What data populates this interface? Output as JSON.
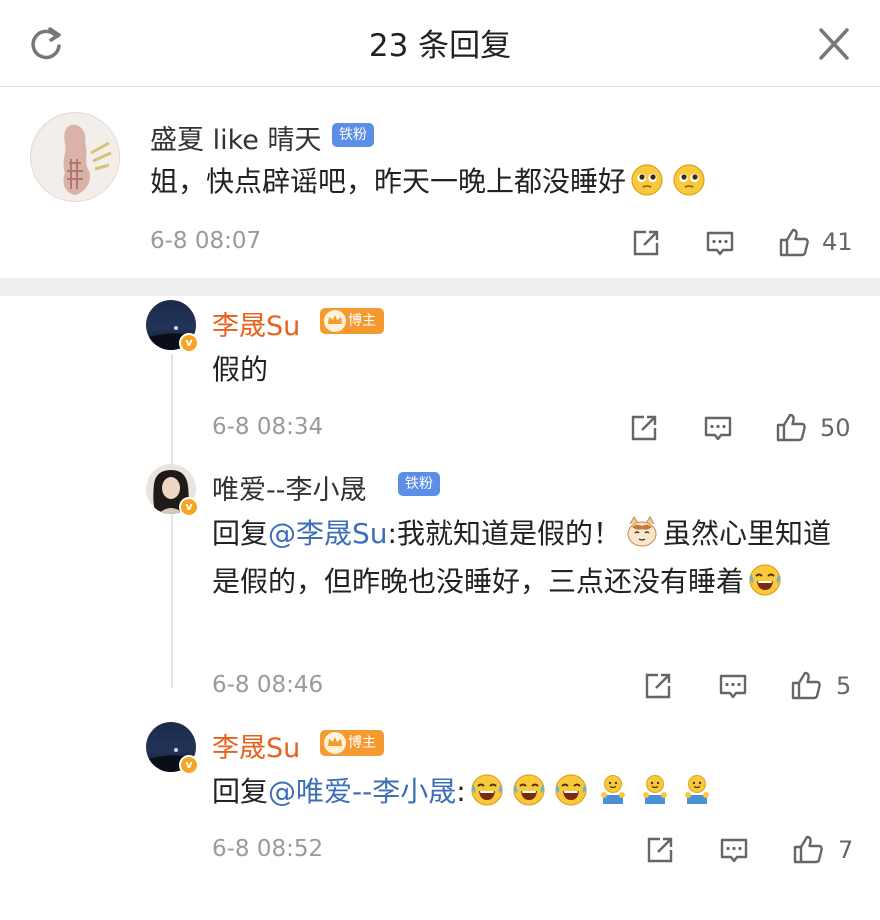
{
  "header": {
    "title": "23 条回复"
  },
  "comments": [
    {
      "author": "盛夏 like 晴天",
      "badge": "铁粉",
      "text": "姐，快点辟谣吧，昨天一晚上都没睡好",
      "time": "6-8 08:07",
      "likes": "41"
    }
  ],
  "replies": [
    {
      "author": "李晟Su",
      "badge": "博主",
      "text": "假的",
      "time": "6-8 08:34",
      "likes": "50"
    },
    {
      "author": "唯爱--李小晟",
      "badge": "铁粉",
      "reply_prefix": "回复",
      "mention": "@李晟Su",
      "text_a": ":我就知道是假的！",
      "text_b": "虽然心里知道是假的，但昨晚也没睡好，三点还没有睡着",
      "time": "6-8 08:46",
      "likes": "5"
    },
    {
      "author": "李晟Su",
      "badge": "博主",
      "reply_prefix": "回复",
      "mention": "@唯爱--李小晟",
      "text": ":",
      "time": "6-8 08:52",
      "likes": "7"
    }
  ],
  "colors": {
    "accent_orange": "#e8621e",
    "mention_blue": "#3d6fb6",
    "fan_tag": "#5b8ee6",
    "host_tag": "#f39a31"
  },
  "icons": [
    "refresh-icon",
    "close-icon",
    "share-icon",
    "comment-icon",
    "like-icon",
    "pray-emoji",
    "cat-emoji",
    "laugh-cry-emoji",
    "hug-emoji",
    "verified-badge-icon"
  ]
}
